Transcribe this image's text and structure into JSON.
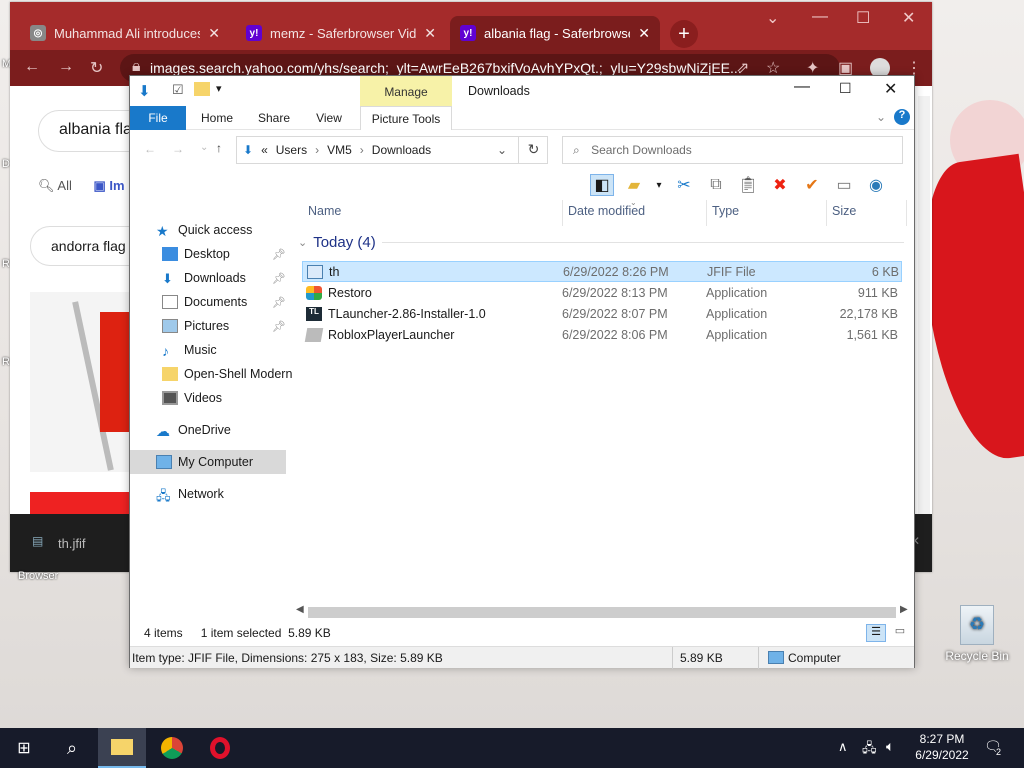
{
  "browser": {
    "tabs": [
      {
        "title": "Muhammad Ali introduces F",
        "active": false
      },
      {
        "title": "memz - Saferbrowser Video",
        "active": false
      },
      {
        "title": "albania flag - Saferbrowser I",
        "active": true
      }
    ],
    "url": "images.search.yahoo.com/yhs/search;_ylt=AwrEeB267bxifVoAvhYPxQt.;_ylu=Y29sbwNiZjEE...",
    "search_query": "albania fla",
    "result_tabs": {
      "all": "All",
      "images": "Im"
    },
    "related_query": "andorra flag",
    "download_item": "th.jfif"
  },
  "explorer": {
    "window_title": "Downloads",
    "contextual_tab": "Manage",
    "ribbon_tabs": [
      "File",
      "Home",
      "Share",
      "View",
      "Picture Tools"
    ],
    "breadcrumb": {
      "root": "«",
      "parts": [
        "Users",
        "VM5",
        "Downloads"
      ]
    },
    "search_placeholder": "Search Downloads",
    "nav": {
      "quick_access": "Quick access",
      "pinned": [
        "Desktop",
        "Downloads",
        "Documents",
        "Pictures"
      ],
      "others": [
        "Music",
        "Open-Shell Modern",
        "Videos"
      ],
      "onedrive": "OneDrive",
      "my_computer": "My Computer",
      "network": "Network"
    },
    "columns": {
      "name": "Name",
      "date": "Date modified",
      "type": "Type",
      "size": "Size"
    },
    "group_label": "Today (4)",
    "files": [
      {
        "name": "th",
        "date": "6/29/2022 8:26 PM",
        "type": "JFIF File",
        "size": "6 KB",
        "selected": true,
        "icon": "jfif-icon"
      },
      {
        "name": "Restoro",
        "date": "6/29/2022 8:13 PM",
        "type": "Application",
        "size": "911 KB",
        "selected": false,
        "icon": "restoro-icon"
      },
      {
        "name": "TLauncher-2.86-Installer-1.0",
        "date": "6/29/2022 8:07 PM",
        "type": "Application",
        "size": "22,178 KB",
        "selected": false,
        "icon": "tlauncher-icon"
      },
      {
        "name": "RobloxPlayerLauncher",
        "date": "6/29/2022 8:06 PM",
        "type": "Application",
        "size": "1,561 KB",
        "selected": false,
        "icon": "roblox-icon"
      }
    ],
    "status": {
      "count": "4 items",
      "selected": "1 item selected",
      "sel_size": "5.89 KB"
    },
    "infobar": {
      "details": "Item type: JFIF File, Dimensions: 275 x 183, Size: 5.89 KB",
      "size": "5.89 KB",
      "location": "Computer"
    }
  },
  "desktop": {
    "recycle_bin": "Recycle Bin",
    "browser_label": "Browser"
  },
  "taskbar": {
    "time": "8:27 PM",
    "date": "6/29/2022",
    "notifications": "2"
  }
}
